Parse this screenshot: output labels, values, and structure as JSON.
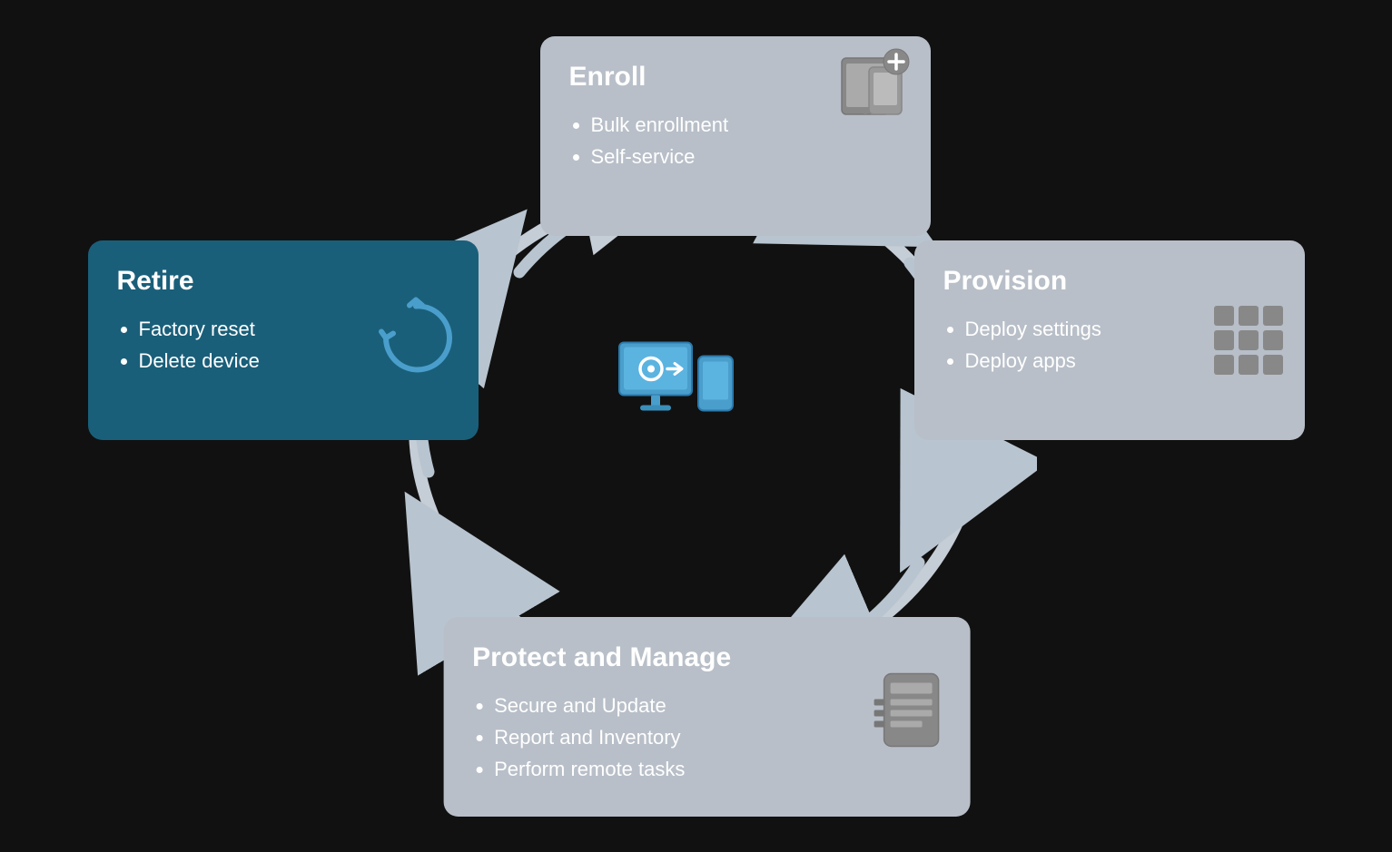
{
  "cards": {
    "enroll": {
      "title": "Enroll",
      "items": [
        "Bulk enrollment",
        "Self-service"
      ]
    },
    "provision": {
      "title": "Provision",
      "items": [
        "Deploy settings",
        "Deploy apps"
      ]
    },
    "protect": {
      "title": "Protect and Manage",
      "items": [
        "Secure and Update",
        "Report and Inventory",
        "Perform remote tasks"
      ]
    },
    "retire": {
      "title": "Retire",
      "items": [
        "Factory reset",
        "Delete device"
      ]
    }
  },
  "colors": {
    "card_default": "#b8bfc7",
    "card_retire": "#1a5f7a",
    "accent": "#4a9cc9",
    "background": "#111111"
  }
}
